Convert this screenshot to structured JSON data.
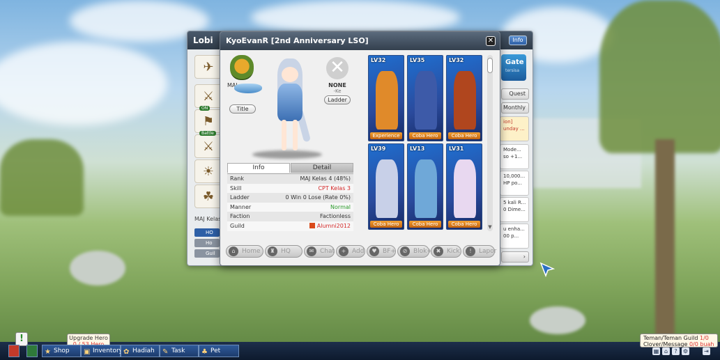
{
  "lobi": {
    "title": "Lobi",
    "info_label": "Info",
    "gate_label": "Gate",
    "gate_sub": "tersisa",
    "badges": [
      "ON",
      "Battle"
    ],
    "rank_label": "MAJ Kelas",
    "rank_items": [
      "HO",
      "Ho",
      "Guil"
    ],
    "right_tabs": [
      "Quest",
      "Monthly"
    ],
    "right_cards": [
      "ion] unday ...",
      "Mode... so +1...",
      "10,000... HP po...",
      "5 kali R... 0 Dime...",
      "u enha... 00 p..."
    ]
  },
  "dialog": {
    "title": "KyoEvanR  [2nd Anniversary LSO]",
    "close_label": "✕",
    "maj_tag": "MAJ",
    "title_btn": "Title",
    "none_label": "NONE",
    "none_sub": "-Ke",
    "ladder_btn": "Ladder",
    "tabs": {
      "info": "Info",
      "detail": "Detail"
    },
    "info_rows": [
      {
        "label": "Rank",
        "value": "MAJ Kelas 4  (48%)",
        "color": "#333333"
      },
      {
        "label": "Skill",
        "value": "CPT Kelas 3",
        "color": "#d42a2a"
      },
      {
        "label": "Ladder",
        "value": "0 Win 0 Lose (Rate 0%)",
        "color": "#333333"
      },
      {
        "label": "Manner",
        "value": "Normal",
        "color": "#2a9a2a"
      },
      {
        "label": "Faction",
        "value": "Factionless",
        "color": "#333333"
      },
      {
        "label": "Guild",
        "value": "Alumni2012",
        "color": "#d42a2a"
      }
    ],
    "heroes": [
      {
        "level": "LV32",
        "tag": "Experience",
        "color": "#e08a2a"
      },
      {
        "level": "LV35",
        "tag": "Coba Hero",
        "color": "#3d5aa8"
      },
      {
        "level": "LV32",
        "tag": "Coba Hero",
        "color": "#b0461e"
      },
      {
        "level": "LV39",
        "tag": "Coba Hero",
        "color": "#c8d0e8"
      },
      {
        "level": "LV13",
        "tag": "Coba Hero",
        "color": "#6fa8d8"
      },
      {
        "level": "LV31",
        "tag": "Coba Hero",
        "color": "#e8d8f0"
      }
    ],
    "actions": [
      {
        "label": "Home",
        "icon": "⌂"
      },
      {
        "label": "HQ",
        "icon": "♜"
      },
      {
        "label": "Chat",
        "icon": "✉"
      },
      {
        "label": "Add",
        "icon": "+"
      },
      {
        "label": "BF+",
        "icon": "♥"
      },
      {
        "label": "Blok+",
        "icon": "⊘"
      },
      {
        "label": "Kick",
        "icon": "✖"
      },
      {
        "label": "Lapor",
        "icon": "!"
      }
    ]
  },
  "hud": {
    "alert": "!",
    "upgrade_title": "Upgrade Hero",
    "upgrade_count": "0 / 53 Hero",
    "buttons": [
      {
        "label": "Shop",
        "icon": "★"
      },
      {
        "label": "Inventory",
        "icon": "▣"
      },
      {
        "label": "Hadiah",
        "icon": "✿"
      },
      {
        "label": "Task",
        "icon": "✎"
      },
      {
        "label": "Pet",
        "icon": "♣"
      }
    ],
    "friend_label": "Teman/Teman Guild",
    "friend_count": "1/0",
    "clover_label": "Clover/Message",
    "clover_count": "0/0 buah",
    "sys_icons": [
      "▦",
      "⌂",
      "?",
      "⚙",
      "⇥"
    ]
  }
}
